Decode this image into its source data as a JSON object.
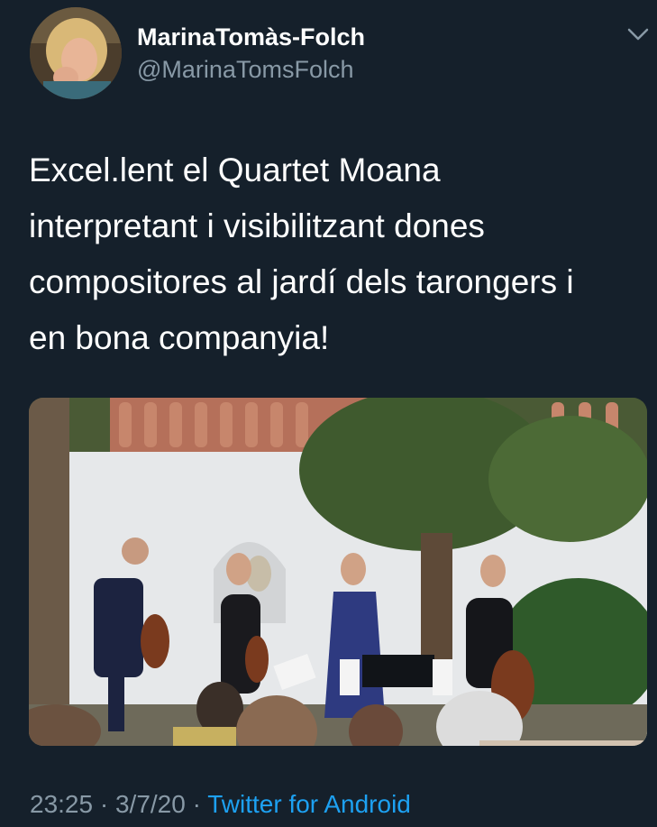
{
  "tweet": {
    "display_name": "MarinaTomàs-Folch",
    "handle": "@MarinaTomsFolch",
    "text": "Excel.lent el Quartet Moana\ninterpretant i visibilitzant dones\ncompositores al jardí dels tarongers i\nen bona companyia!",
    "time": "23:25",
    "separator": "·",
    "date": "3/7/20",
    "source": "Twitter for Android",
    "menu_icon": "chevron-down-icon"
  },
  "colors": {
    "background": "#15202b",
    "secondary_text": "#8899a6",
    "link": "#1da1f2"
  }
}
